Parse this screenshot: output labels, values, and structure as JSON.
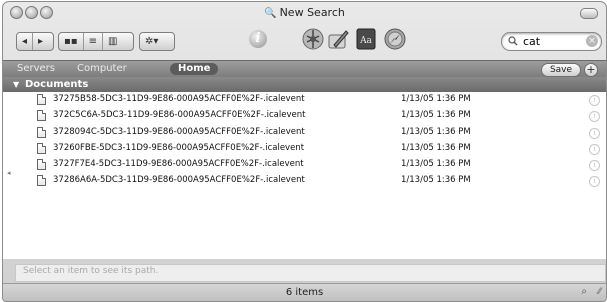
{
  "window": {
    "title": "New Search"
  },
  "toolbar": {
    "nav_back": "◂",
    "nav_forward": "▸",
    "view_icon": "▪▪",
    "view_list": "≡",
    "view_column": "▥",
    "action_label": "✲▾",
    "info_glyph": "i",
    "search": {
      "value": "cat",
      "placeholder": ""
    }
  },
  "scope": {
    "items": [
      "Servers",
      "Computer",
      "Home"
    ],
    "selected": "Home",
    "save_label": "Save",
    "add_glyph": "+"
  },
  "group": {
    "label": "Documents"
  },
  "results": [
    {
      "name": "37275B58-5DC3-11D9-9E86-000A95ACFF0E%2F-.icalevent",
      "date": "1/13/05 1:36 PM"
    },
    {
      "name": "372C5C6A-5DC3-11D9-9E86-000A95ACFF0E%2F-.icalevent",
      "date": "1/13/05 1:36 PM"
    },
    {
      "name": "3728094C-5DC3-11D9-9E86-000A95ACFF0E%2F-.icalevent",
      "date": "1/13/05 1:36 PM"
    },
    {
      "name": "37260FBE-5DC3-11D9-9E86-000A95ACFF0E%2F-.icalevent",
      "date": "1/13/05 1:36 PM"
    },
    {
      "name": "3727F7E4-5DC3-11D9-9E86-000A95ACFF0E%2F-.icalevent",
      "date": "1/13/05 1:36 PM"
    },
    {
      "name": "37286A6A-5DC3-11D9-9E86-000A95ACFF0E%2F-.icalevent",
      "date": "1/13/05 1:36 PM"
    }
  ],
  "pathbar": {
    "hint": "Select an item to see its path."
  },
  "status": {
    "count": "6 items"
  },
  "icons": [
    "magnifier-icon",
    "info-icon",
    "network-icon",
    "pencil-icon",
    "dictionary-icon",
    "safari-icon",
    "search-icon"
  ]
}
